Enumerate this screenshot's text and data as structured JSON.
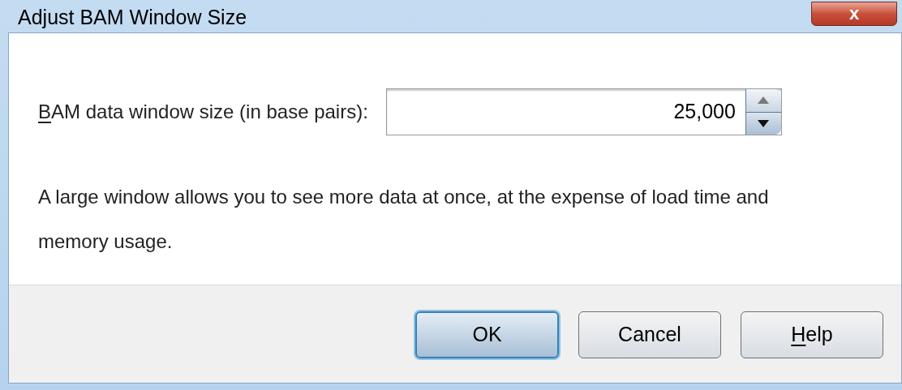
{
  "window": {
    "title": "Adjust BAM Window Size",
    "close_label": "x"
  },
  "field": {
    "label": "BAM data window size (in base pairs):",
    "mnemonic_first": true,
    "value": "25,000"
  },
  "message": "A large window allows you to see more data at once, at the expense of load time and memory usage.",
  "buttons": [
    {
      "label": "OK",
      "default": true,
      "mnemonic_first": false
    },
    {
      "label": "Cancel",
      "default": false,
      "mnemonic_first": false
    },
    {
      "label": "Help",
      "default": false,
      "mnemonic_first": true
    }
  ]
}
